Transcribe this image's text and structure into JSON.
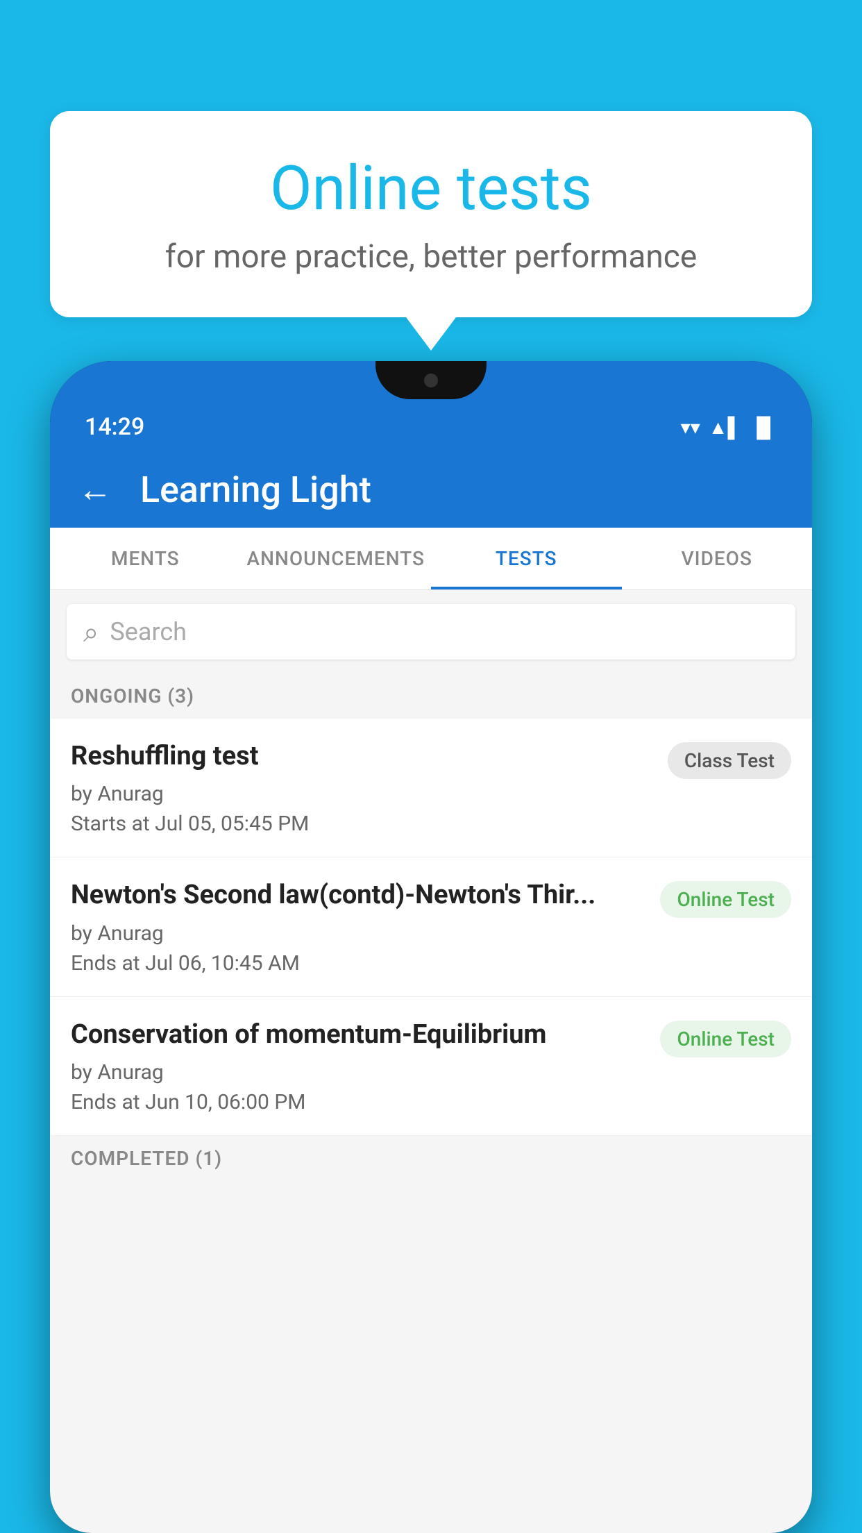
{
  "background_color": "#1ab8e8",
  "speech_bubble": {
    "title": "Online tests",
    "subtitle": "for more practice, better performance"
  },
  "phone": {
    "status_bar": {
      "time": "14:29",
      "icons": [
        "▼",
        "▲",
        "▌"
      ]
    },
    "app_bar": {
      "title": "Learning Light",
      "back_label": "←"
    },
    "tabs": [
      {
        "label": "MENTS",
        "active": false
      },
      {
        "label": "ANNOUNCEMENTS",
        "active": false
      },
      {
        "label": "TESTS",
        "active": true
      },
      {
        "label": "VIDEOS",
        "active": false
      }
    ],
    "search": {
      "placeholder": "Search",
      "icon": "🔍"
    },
    "sections": [
      {
        "header": "ONGOING (3)",
        "items": [
          {
            "title": "Reshuffling test",
            "by": "by Anurag",
            "date": "Starts at  Jul 05, 05:45 PM",
            "badge": "Class Test",
            "badge_type": "class"
          },
          {
            "title": "Newton's Second law(contd)-Newton's Thir...",
            "by": "by Anurag",
            "date": "Ends at  Jul 06, 10:45 AM",
            "badge": "Online Test",
            "badge_type": "online"
          },
          {
            "title": "Conservation of momentum-Equilibrium",
            "by": "by Anurag",
            "date": "Ends at  Jun 10, 06:00 PM",
            "badge": "Online Test",
            "badge_type": "online"
          }
        ]
      },
      {
        "header": "COMPLETED (1)",
        "items": []
      }
    ]
  }
}
